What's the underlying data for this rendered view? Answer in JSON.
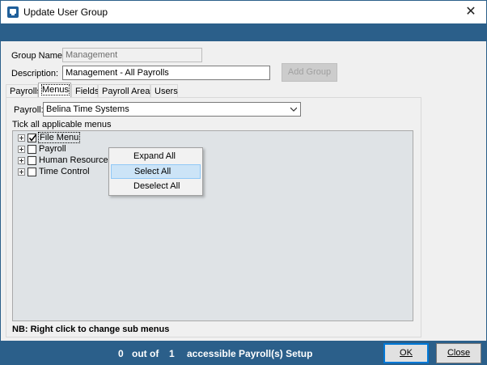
{
  "window": {
    "title": "Update User Group"
  },
  "form": {
    "group_name_label": "Group Name:",
    "group_name_value": "Management",
    "description_label": "Description:",
    "description_value": "Management - All Payrolls",
    "add_group_button": "Add Group"
  },
  "tabs": [
    {
      "label": "Payrolls",
      "active": false
    },
    {
      "label": "Menus",
      "active": true
    },
    {
      "label": "Fields",
      "active": false
    },
    {
      "label": "Payroll Areas",
      "active": false
    },
    {
      "label": "Users",
      "active": false
    }
  ],
  "menus_tab": {
    "payroll_label": "Payroll:",
    "payroll_selected": "Belina Time Systems",
    "instruction": "Tick all applicable menus",
    "tree": [
      {
        "label": "File Menu",
        "checked": true,
        "focused": true
      },
      {
        "label": "Payroll",
        "checked": false,
        "focused": false
      },
      {
        "label": "Human Resources",
        "checked": false,
        "focused": false
      },
      {
        "label": "Time Control",
        "checked": false,
        "focused": false
      }
    ],
    "note": "NB: Right click to change sub menus"
  },
  "context_menu": {
    "items": [
      {
        "label": "Expand All",
        "highlighted": false
      },
      {
        "label": "Select All",
        "highlighted": true
      },
      {
        "label": "Deselect All",
        "highlighted": false
      }
    ]
  },
  "footer": {
    "count": "0",
    "out_of": "out of",
    "total": "1",
    "suffix": "accessible Payroll(s) Setup",
    "ok_button": "OK",
    "close_button": "Close"
  },
  "colors": {
    "accent_band": "#2b5f8a",
    "highlight": "#cce4f7"
  }
}
